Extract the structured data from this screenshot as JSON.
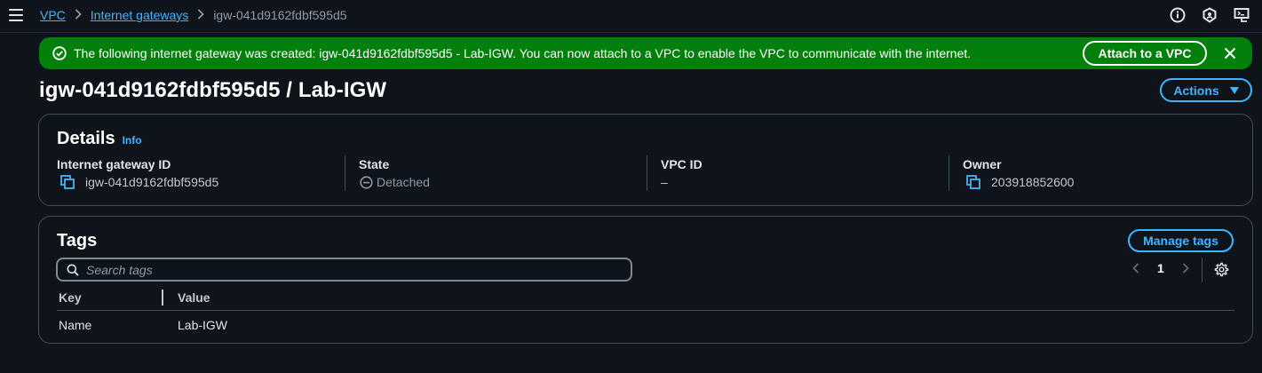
{
  "breadcrumb": {
    "items": [
      "VPC",
      "Internet gateways"
    ],
    "current": "igw-041d9162fdbf595d5"
  },
  "flash": {
    "message": "The following internet gateway was created: igw-041d9162fdbf595d5 - Lab-IGW. You can now attach to a VPC to enable the VPC to communicate with the internet.",
    "action_label": "Attach to a VPC",
    "type": "success",
    "color": "#037f0c"
  },
  "page": {
    "title": "igw-041d9162fdbf595d5 / Lab-IGW",
    "actions_label": "Actions"
  },
  "details": {
    "title": "Details",
    "info_label": "Info",
    "columns": [
      {
        "label": "Internet gateway ID",
        "value": "igw-041d9162fdbf595d5",
        "icon": "copy-icon"
      },
      {
        "label": "State",
        "value": "Detached",
        "icon": "detached-status-icon"
      },
      {
        "label": "VPC ID",
        "value": "–"
      },
      {
        "label": "Owner",
        "value": "203918852600",
        "icon": "copy-icon"
      }
    ]
  },
  "tags": {
    "title": "Tags",
    "manage_label": "Manage tags",
    "search_placeholder": "Search tags",
    "page": "1",
    "columns": [
      "Key",
      "Value"
    ],
    "rows": [
      {
        "key": "Name",
        "value": "Lab-IGW"
      }
    ]
  },
  "colors": {
    "link": "#42b4ff",
    "background": "#0f141a",
    "success": "#037f0c"
  }
}
